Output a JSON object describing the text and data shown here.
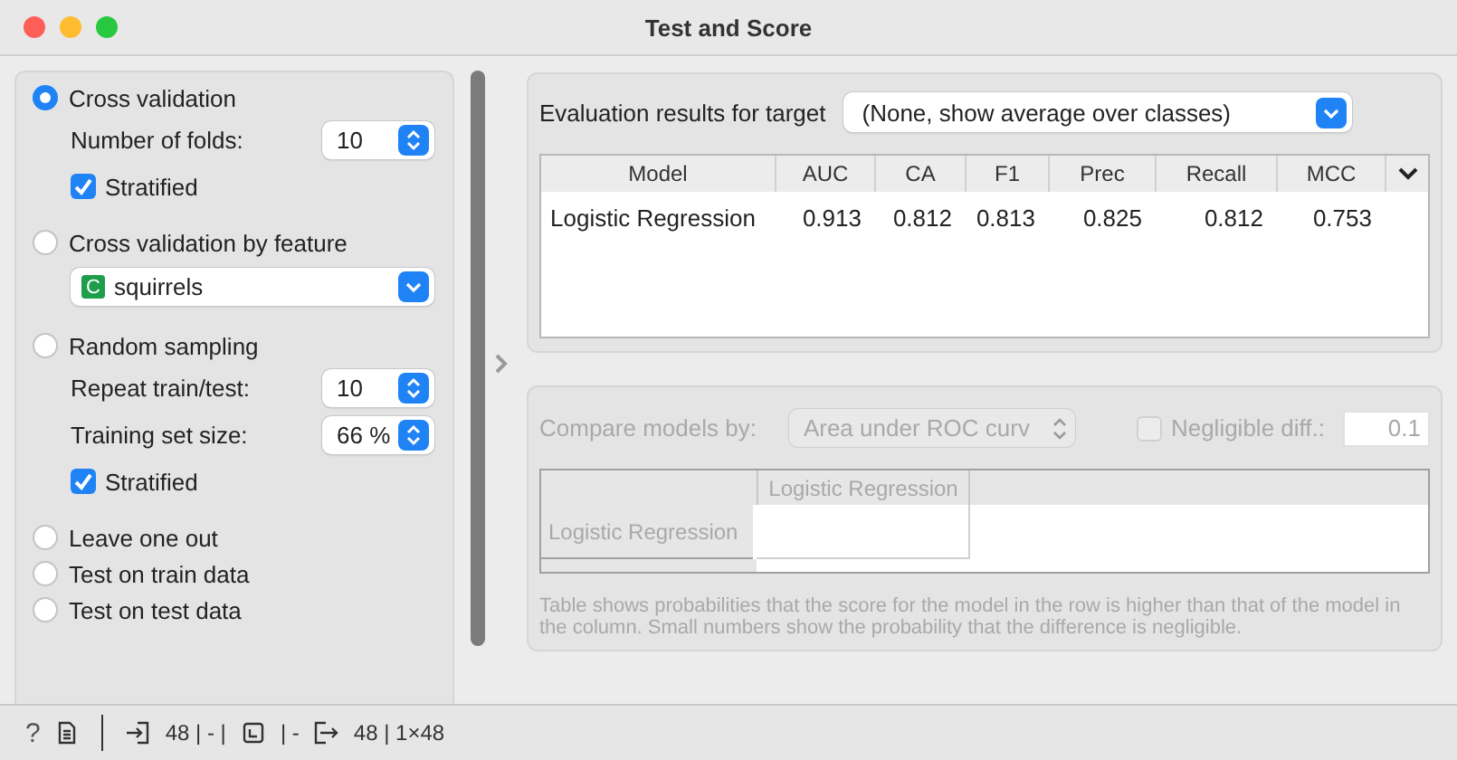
{
  "window": {
    "title": "Test and Score"
  },
  "sampling": {
    "options": [
      {
        "label": "Cross validation",
        "selected": true,
        "settings": [
          {
            "kind": "spin",
            "label": "Number of folds:",
            "value": "10"
          },
          {
            "kind": "checkbox",
            "label": "Stratified",
            "checked": true
          }
        ]
      },
      {
        "label": "Cross validation by feature",
        "selected": false,
        "settings": [
          {
            "kind": "combo",
            "badge": "C",
            "value": "squirrels"
          }
        ]
      },
      {
        "label": "Random sampling",
        "selected": false,
        "settings": [
          {
            "kind": "spin",
            "label": "Repeat train/test:",
            "value": "10"
          },
          {
            "kind": "spin",
            "label": "Training set size:",
            "value": "66 %"
          },
          {
            "kind": "checkbox",
            "label": "Stratified",
            "checked": true
          }
        ]
      },
      {
        "label": "Leave one out",
        "selected": false
      },
      {
        "label": "Test on train data",
        "selected": false
      },
      {
        "label": "Test on test data",
        "selected": false
      }
    ]
  },
  "evaluation": {
    "target_label": "Evaluation results for target",
    "target_value": "(None, show average over classes)",
    "table": {
      "columns": [
        "Model",
        "AUC",
        "CA",
        "F1",
        "Prec",
        "Recall",
        "MCC"
      ],
      "rows": [
        [
          "Logistic Regression",
          "0.913",
          "0.812",
          "0.813",
          "0.825",
          "0.812",
          "0.753"
        ]
      ]
    }
  },
  "comparison": {
    "disabled": true,
    "compare_label": "Compare models by:",
    "compare_value": "Area under ROC curv",
    "negligible": {
      "label": "Negligible diff.:",
      "checked": false,
      "value": "0.1"
    },
    "table": {
      "columns": [
        "Logistic Regression"
      ],
      "rows": [
        "Logistic Regression"
      ]
    },
    "note": "Table shows probabilities that the score for the model in the row is higher than that of the model in the column. Small numbers show the probability that the difference is negligible."
  },
  "status_bar": {
    "help": "?",
    "input": "48 | - |",
    "middle": "| -",
    "output": "48 | 1×48"
  }
}
